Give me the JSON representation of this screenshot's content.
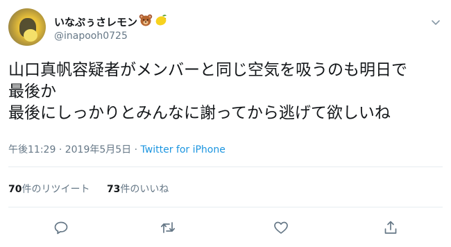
{
  "user": {
    "display_name": "いなぷぅさレモン",
    "handle": "@inapooh0725",
    "emojis": [
      "bear-face-emoji",
      "lemon-emoji"
    ]
  },
  "tweet": {
    "lines": [
      "山口真帆容疑者がメンバーと同じ空気を吸うのも明日で",
      "最後か",
      "最後にしっかりとみんなに謝ってから逃げて欲しいね"
    ],
    "time": "午後11:29",
    "separator": "·",
    "date": "2019年5月5日",
    "source": "Twitter for iPhone"
  },
  "stats": {
    "retweets_count": "70",
    "retweets_label": "件のリツイート",
    "likes_count": "73",
    "likes_label": "件のいいね"
  },
  "actions": [
    "reply-icon",
    "retweet-icon",
    "like-icon",
    "share-icon"
  ],
  "colors": {
    "text": "#14171a",
    "secondary": "#657786",
    "link": "#1b95e0",
    "divider": "#e6ecf0"
  }
}
